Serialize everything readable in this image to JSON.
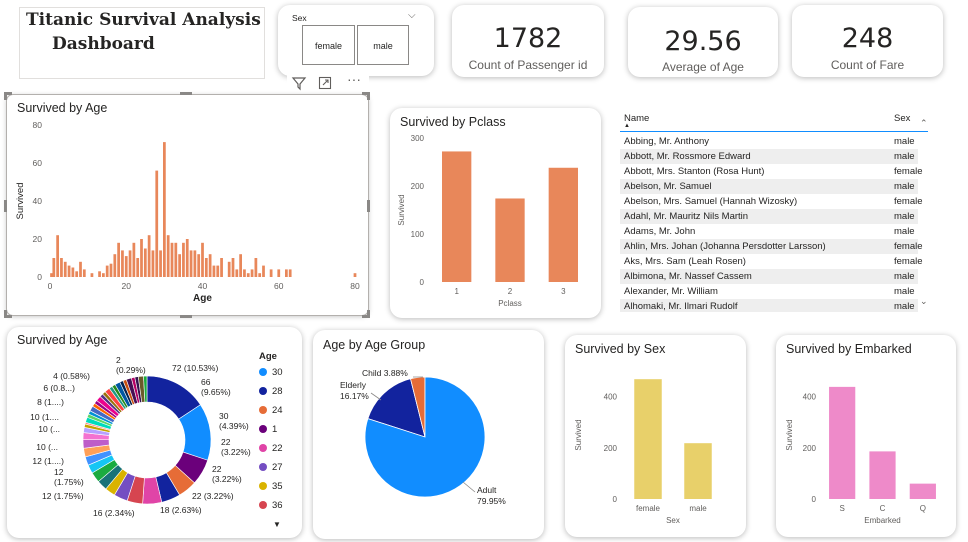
{
  "header": {
    "title_line1": "Titanic Survival Analysis",
    "title_line2": "Dashboard"
  },
  "slicer": {
    "label": "Sex",
    "options": [
      "female",
      "male"
    ]
  },
  "kpis": [
    {
      "value": "1782",
      "label": "Count of Passenger id"
    },
    {
      "value": "29.56",
      "label": "Average of Age"
    },
    {
      "value": "248",
      "label": "Count of Fare"
    }
  ],
  "bar_color": "#E8875A",
  "sex_color": "#E8D06A",
  "embarked_color": "#EE8AC9",
  "chart_data": [
    {
      "id": "survived-by-age-bar",
      "type": "bar",
      "title": "Survived by Age",
      "xlabel": "Age",
      "ylabel": "Survived",
      "x_ticks": [
        "0",
        "20",
        "40",
        "60",
        "80"
      ],
      "y_ticks": [
        "0",
        "20",
        "40",
        "60",
        "80"
      ],
      "xlim": [
        0,
        80
      ],
      "ylim": [
        0,
        80
      ],
      "x": [
        0.4,
        0.9,
        1,
        2,
        3,
        4,
        5,
        6,
        7,
        8,
        9,
        11,
        13,
        14,
        15,
        16,
        17,
        18,
        19,
        20,
        21,
        22,
        23,
        24,
        25,
        26,
        27,
        28,
        29,
        30,
        31,
        32,
        33,
        34,
        35,
        36,
        37,
        38,
        39,
        40,
        41,
        42,
        43,
        44,
        45,
        47,
        48,
        49,
        50,
        51,
        52,
        53,
        54,
        55,
        56,
        58,
        60,
        62,
        63,
        80
      ],
      "values": [
        2,
        1,
        10,
        22,
        10,
        8,
        6,
        5,
        3,
        8,
        4,
        2,
        3,
        2,
        6,
        7,
        12,
        18,
        14,
        11,
        14,
        18,
        10,
        20,
        15,
        22,
        14,
        56,
        14,
        71,
        22,
        18,
        18,
        12,
        18,
        20,
        14,
        14,
        12,
        18,
        10,
        12,
        6,
        6,
        10,
        8,
        10,
        4,
        12,
        4,
        2,
        4,
        10,
        2,
        6,
        4,
        4,
        4,
        4,
        2
      ]
    },
    {
      "id": "survived-by-pclass",
      "type": "bar",
      "title": "Survived by Pclass",
      "xlabel": "Pclass",
      "ylabel": "Survived",
      "categories": [
        "1",
        "2",
        "3"
      ],
      "values": [
        272,
        174,
        238
      ],
      "y_ticks": [
        "0",
        "100",
        "200",
        "300"
      ],
      "ylim": [
        0,
        300
      ]
    },
    {
      "id": "survived-by-age-donut",
      "type": "pie",
      "title": "Survived by Age",
      "legend_title": "Age",
      "legend": [
        {
          "label": "30",
          "color": "#118DFF"
        },
        {
          "label": "28",
          "color": "#12239E"
        },
        {
          "label": "24",
          "color": "#E66C37"
        },
        {
          "label": "1",
          "color": "#6B007B"
        },
        {
          "label": "22",
          "color": "#E044A7"
        },
        {
          "label": "27",
          "color": "#744EC2"
        },
        {
          "label": "35",
          "color": "#D9B300"
        },
        {
          "label": "36",
          "color": "#D64550"
        }
      ],
      "values": [
        72,
        66,
        30,
        22,
        22,
        22,
        18,
        16,
        12,
        12,
        12,
        10,
        10,
        10,
        10,
        8,
        6,
        4,
        2
      ],
      "slice_labels": [
        {
          "text1": "72 (10.53%)",
          "text2": ""
        },
        {
          "text1": "66",
          "text2": "(9.65%)"
        },
        {
          "text1": "30",
          "text2": "(4.39%)"
        },
        {
          "text1": "22",
          "text2": "(3.22%)"
        },
        {
          "text1": "22",
          "text2": "(3.22%)"
        },
        {
          "text1": "22 (3.22%)",
          "text2": ""
        },
        {
          "text1": "18 (2.63%)",
          "text2": ""
        },
        {
          "text1": "16 (2.34%)",
          "text2": ""
        },
        {
          "text1": "12 (1.75%)",
          "text2": ""
        },
        {
          "text1": "12",
          "text2": "(1.75%)"
        },
        {
          "text1": "12 (1....)",
          "text2": ""
        },
        {
          "text1": "10 (...",
          "text2": ""
        },
        {
          "text1": "10 (...",
          "text2": ""
        },
        {
          "text1": "10 (1....",
          "text2": ""
        },
        {
          "text1": "8 (1....)",
          "text2": ""
        },
        {
          "text1": "6 (0.8...)",
          "text2": ""
        },
        {
          "text1": "4 (0.58%)",
          "text2": ""
        },
        {
          "text1": "2",
          "text2": "(0.29%)"
        }
      ]
    },
    {
      "id": "age-by-age-group",
      "type": "pie",
      "title": "Age by Age Group",
      "slices": [
        {
          "label": "Adult",
          "percent": "79.95%",
          "value": 79.95,
          "color": "#118DFF"
        },
        {
          "label": "Elderly",
          "percent": "16.17%",
          "value": 16.17,
          "color": "#12239E"
        },
        {
          "label": "Child",
          "percent": "3.88%",
          "value": 3.88,
          "color": "#E66C37"
        }
      ]
    },
    {
      "id": "survived-by-sex",
      "type": "bar",
      "title": "Survived by Sex",
      "xlabel": "Sex",
      "ylabel": "Survived",
      "categories": [
        "female",
        "male"
      ],
      "values": [
        468,
        218
      ],
      "y_ticks": [
        "0",
        "200",
        "400"
      ],
      "ylim": [
        0,
        500
      ]
    },
    {
      "id": "survived-by-embarked",
      "type": "bar",
      "title": "Survived by Embarked",
      "xlabel": "Embarked",
      "ylabel": "Survived",
      "categories": [
        "S",
        "C",
        "Q"
      ],
      "values": [
        438,
        186,
        60
      ],
      "y_ticks": [
        "0",
        "200",
        "400"
      ],
      "ylim": [
        0,
        500
      ]
    }
  ],
  "table": {
    "headers": [
      "Name",
      "Sex"
    ],
    "rows": [
      [
        "Abbing, Mr. Anthony",
        "male"
      ],
      [
        "Abbott, Mr. Rossmore Edward",
        "male"
      ],
      [
        "Abbott, Mrs. Stanton (Rosa Hunt)",
        "female"
      ],
      [
        "Abelson, Mr. Samuel",
        "male"
      ],
      [
        "Abelson, Mrs. Samuel (Hannah Wizosky)",
        "female"
      ],
      [
        "Adahl, Mr. Mauritz Nils Martin",
        "male"
      ],
      [
        "Adams, Mr. John",
        "male"
      ],
      [
        "Ahlin, Mrs. Johan (Johanna Persdotter Larsson)",
        "female"
      ],
      [
        "Aks, Mrs. Sam (Leah Rosen)",
        "female"
      ],
      [
        "Albimona, Mr. Nassef Cassem",
        "male"
      ],
      [
        "Alexander, Mr. William",
        "male"
      ],
      [
        "Alhomaki, Mr. Ilmari Rudolf",
        "male"
      ]
    ]
  }
}
